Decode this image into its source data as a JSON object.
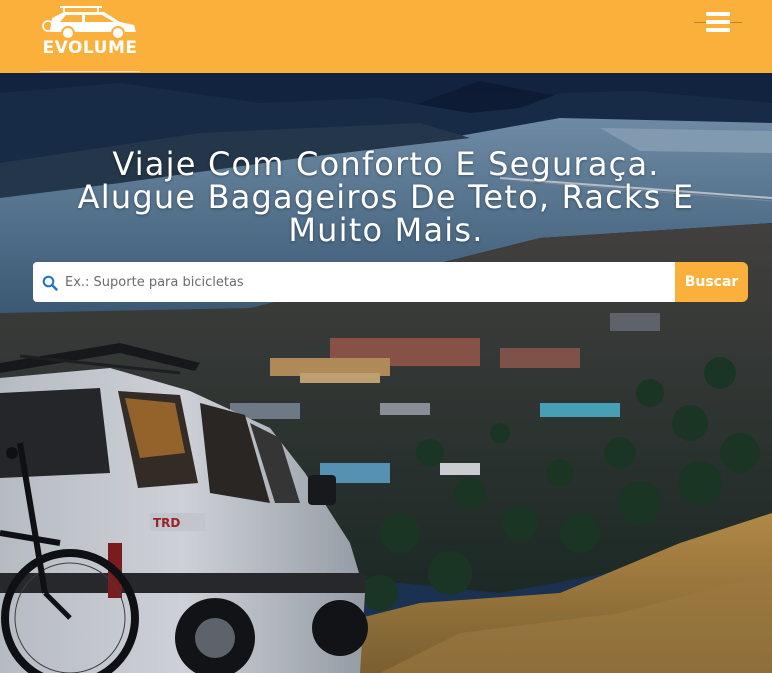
{
  "header": {
    "logo_text": "EVOLUME",
    "menu_icon": "hamburger-menu-icon",
    "background_color": "#fbb03b"
  },
  "hero": {
    "headline": "Viaje Com Conforto E Seguraça. Alugue Bagageiros De Teto, Racks E Muito Mais.",
    "background_image": "hillside-suv-bike-rack-over-river-town-photo"
  },
  "search": {
    "placeholder": "Ex.: Suporte para bicicletas",
    "value": "",
    "button_label": "Buscar",
    "icon": "search-icon"
  },
  "colors": {
    "accent": "#fbb03b",
    "text_light": "#ffffff"
  }
}
